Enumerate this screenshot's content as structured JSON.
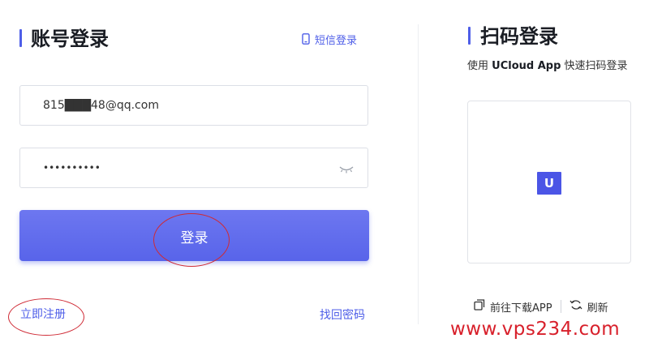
{
  "account_login": {
    "title": "账号登录",
    "sms_login_label": "短信登录",
    "email_value": "815███48@qq.com",
    "password_value": "••••••••••",
    "login_button": "登录",
    "register_link": "立即注册",
    "forgot_password_link": "找回密码"
  },
  "qr_login": {
    "title": "扫码登录",
    "subtitle_prefix": "使用 ",
    "subtitle_app": "UCloud App",
    "subtitle_suffix": " 快速扫码登录",
    "logo_letter": "U",
    "download_app_label": "前往下载APP",
    "refresh_label": "刷新"
  },
  "watermark": "www.vps234.com",
  "colors": {
    "accent": "#4e5ee8",
    "annotation_red": "#cf2a35",
    "watermark_red": "#d8202b"
  },
  "icons": {
    "sms": "phone-icon",
    "password_toggle": "eye-closed-icon",
    "download": "copy-icon",
    "refresh": "refresh-icon"
  }
}
